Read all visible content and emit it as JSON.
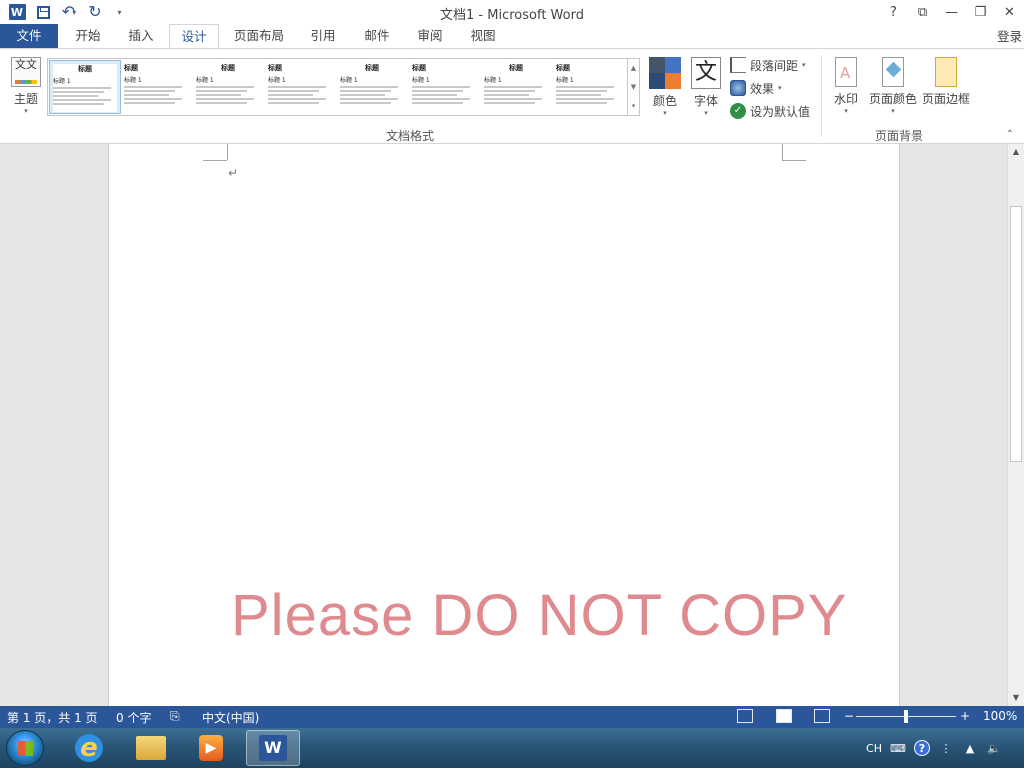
{
  "window": {
    "title": "文档1 - Microsoft Word",
    "help": "?",
    "restore_ribbon": "⧉",
    "minimize": "—",
    "restore": "❐",
    "close": "✕"
  },
  "qat": {
    "app_logo": "W",
    "undo": "↶",
    "redo": "↻",
    "customize": "▾"
  },
  "tabs": [
    {
      "label": "文件"
    },
    {
      "label": "开始"
    },
    {
      "label": "插入"
    },
    {
      "label": "设计"
    },
    {
      "label": "页面布局"
    },
    {
      "label": "引用"
    },
    {
      "label": "邮件"
    },
    {
      "label": "审阅"
    },
    {
      "label": "视图"
    }
  ],
  "account": {
    "login": "登录"
  },
  "ribbon": {
    "theme_label": "主题",
    "theme_icon_text": "文文",
    "style_gallery": [
      {
        "title": "标题",
        "heading": "标题 1",
        "selected": true
      },
      {
        "title": "标题",
        "heading": "标题 1",
        "selected": false
      },
      {
        "title": "标题",
        "heading": "标题 1",
        "selected": false
      },
      {
        "title": "标题",
        "heading": "标题 1",
        "selected": false
      },
      {
        "title": "标题",
        "heading": "标题 1",
        "selected": false
      },
      {
        "title": "标题",
        "heading": "标题 1",
        "selected": false
      },
      {
        "title": "标题",
        "heading": "标题 1",
        "selected": false
      },
      {
        "title": "标题",
        "heading": "标题 1",
        "selected": false
      }
    ],
    "doc_format_group": "文档格式",
    "colors_label": "颜色",
    "color_swatches": [
      "#44546a",
      "#4472c4",
      "#2b4a75",
      "#ed7d31"
    ],
    "fonts_label": "字体",
    "fonts_icon_text": "文",
    "paragraph_spacing": "段落间距",
    "effects": "效果",
    "set_default": "设为默认值",
    "watermark": "水印",
    "page_color": "页面颜色",
    "page_border": "页面边框",
    "page_background_group": "页面背景"
  },
  "document": {
    "paragraph_mark": "↵",
    "watermark_text": "Please   DO   NOT   COPY"
  },
  "status": {
    "page": "第 1 页，共 1 页",
    "words": "0 个字",
    "language": "中文(中国)",
    "zoom": "100%",
    "zoom_out": "−",
    "zoom_in": "+"
  },
  "taskbar": {
    "ie_glyph": "e",
    "media_glyph": "▶",
    "word_glyph": "W",
    "ime": "CH",
    "help": "?"
  }
}
